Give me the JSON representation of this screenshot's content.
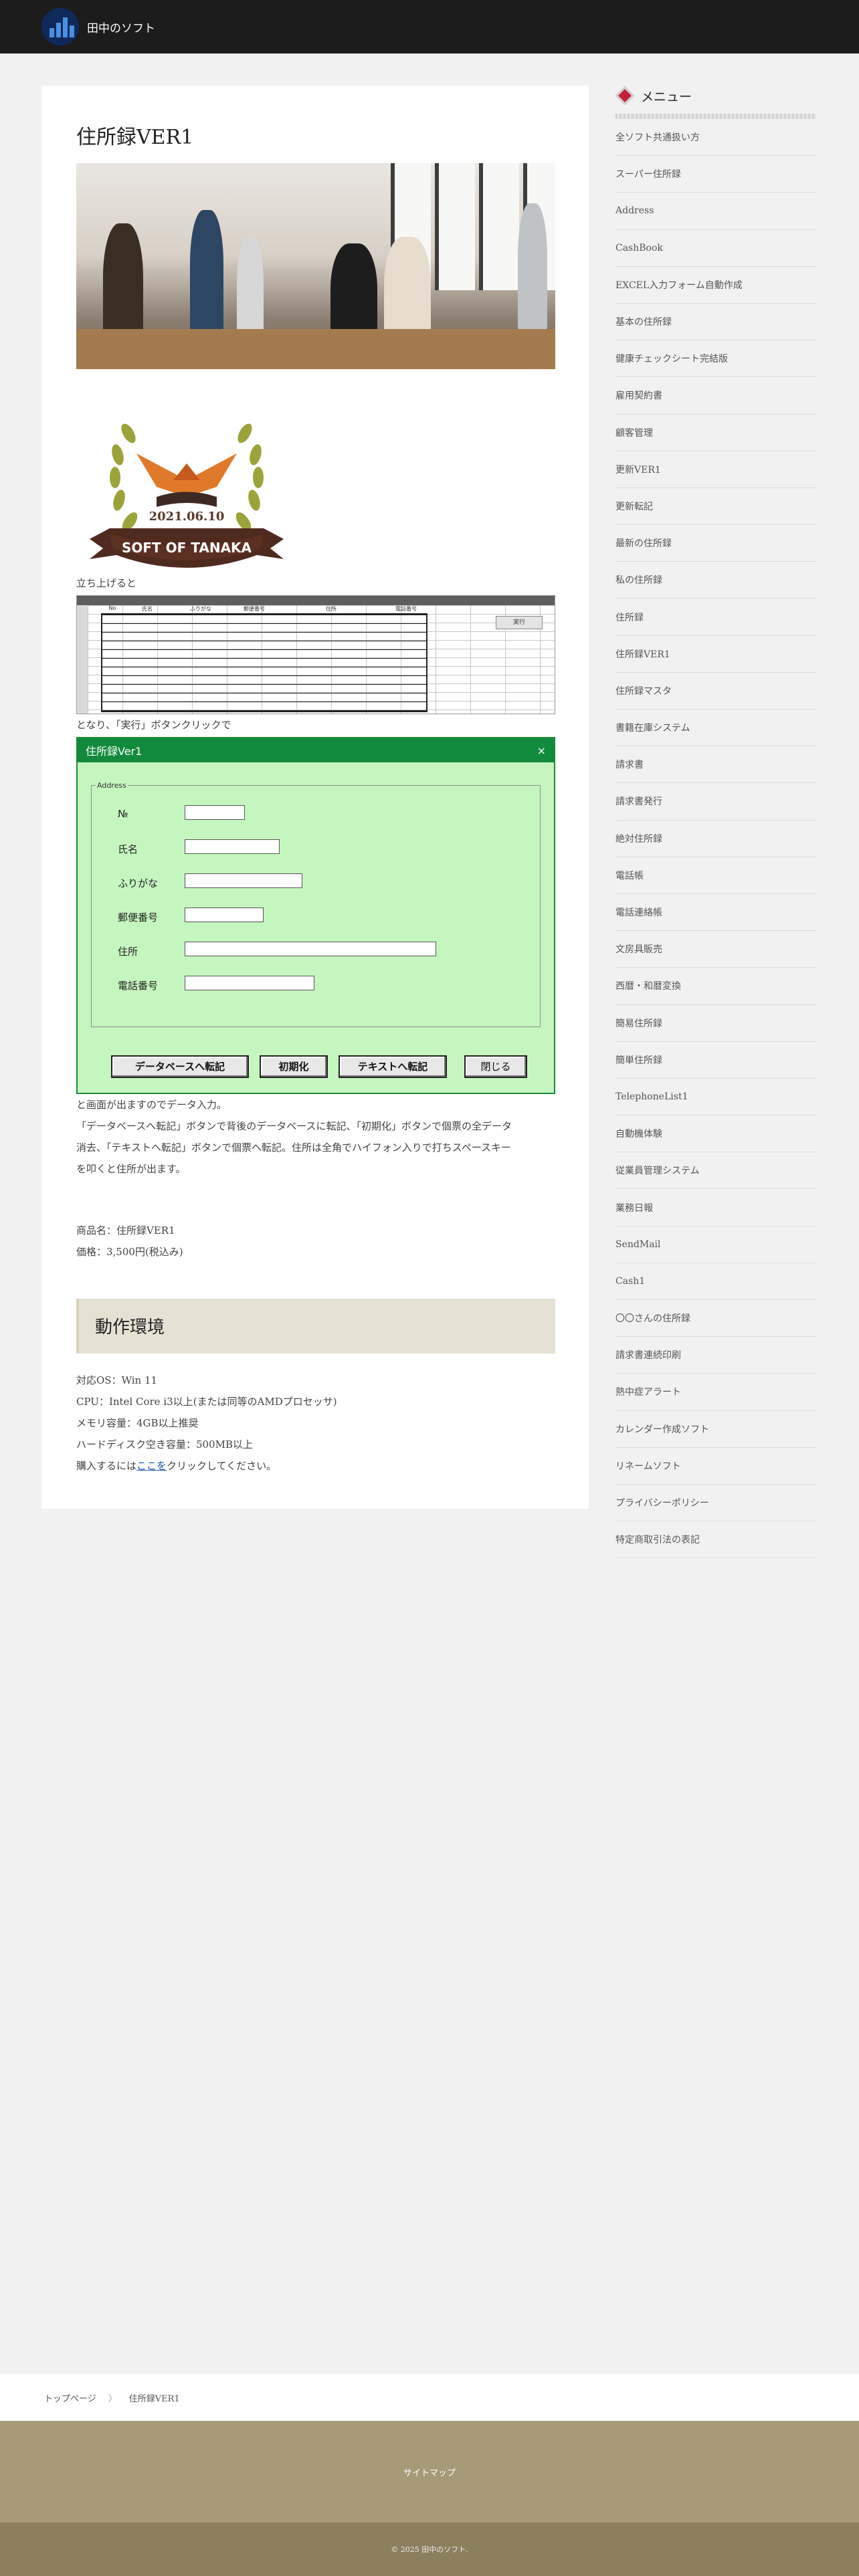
{
  "header": {
    "site_name": "田中のソフト",
    "logo_icon": "building-chart-logo"
  },
  "post": {
    "title": "住所録VER1",
    "badge_date": "2021.06.10",
    "badge_text": "SOFT OF TANAKA",
    "intro_1": "立ち上げると",
    "intro_2": "となり、「実行」ボタンクリックで",
    "sheet": {
      "headers": [
        "No",
        "氏名",
        "ふりがな",
        "郵便番号",
        "住所",
        "電話番号"
      ],
      "run_button": "実行"
    },
    "dialog": {
      "title": "住所録Ver1",
      "close": "×",
      "group": "Address",
      "fields": [
        "№",
        "氏名",
        "ふりがな",
        "郵便番号",
        "住所",
        "電話番号"
      ],
      "buttons": [
        "データベースへ転記",
        "初期化",
        "テキストへ転記",
        "閉じる"
      ]
    },
    "desc_1": "と画面が出ますのでデータ入力。",
    "desc_2": "「データベースへ転記」ボタンで背後のデータベースに転記、「初期化」ボタンで個票の全データ",
    "desc_3": "消去、「テキストへ転記」ボタンで個票へ転記。住所は全角でハイフォン入りで打ちスペースキー",
    "desc_4": "を叩くと住所が出ます。",
    "product_name": "商品名：住所録VER1",
    "price": "価格：3,500円(税込み)",
    "env_title": "動作環境",
    "env": {
      "os": "対応OS：Win 11",
      "cpu": "CPU：Intel Core i3以上(または同等のAMDプロセッサ)",
      "memory": "メモリ容量：4GB以上推奨",
      "disk": "ハードディスク空き容量：500MB以上",
      "buy_prefix": "購入するには",
      "buy_link": "ここを",
      "buy_suffix": "クリックしてください。"
    }
  },
  "sidebar": {
    "heading": "メニュー",
    "items": [
      "全ソフト共通扱い方",
      "スーパー住所録",
      "Address",
      "CashBook",
      "EXCEL入力フォーム自動作成",
      "基本の住所録",
      "健康チェックシート完結版",
      "雇用契約書",
      "顧客管理",
      "更新VER1",
      "更新転記",
      "最新の住所録",
      "私の住所録",
      "住所録",
      "住所録VER1",
      "住所録マスタ",
      "書籍在庫システム",
      "請求書",
      "請求書発行",
      "絶対住所録",
      "電話帳",
      "電話連絡帳",
      "文房具販売",
      "西暦・和暦変換",
      "簡易住所録",
      "簡単住所録",
      "TelephoneList1",
      "自動機体験",
      "従業員管理システム",
      "業務日報",
      "SendMail",
      "Cash1",
      "〇〇さんの住所録",
      "請求書連続印刷",
      "熱中症アラート",
      "カレンダー作成ソフト",
      "リネームソフト",
      "プライバシーポリシー",
      "特定商取引法の表記"
    ]
  },
  "breadcrumb": {
    "home": "トップページ",
    "separator": "〉",
    "current": "住所録VER1"
  },
  "footer": {
    "sitemap": "サイトマップ",
    "copyright": "© 2025 田中のソフト."
  },
  "colors": {
    "dialog_green": "#128a3d",
    "dialog_bg": "#c6f6c0",
    "footer": "#a69a79",
    "accent_red": "#c0223a"
  }
}
